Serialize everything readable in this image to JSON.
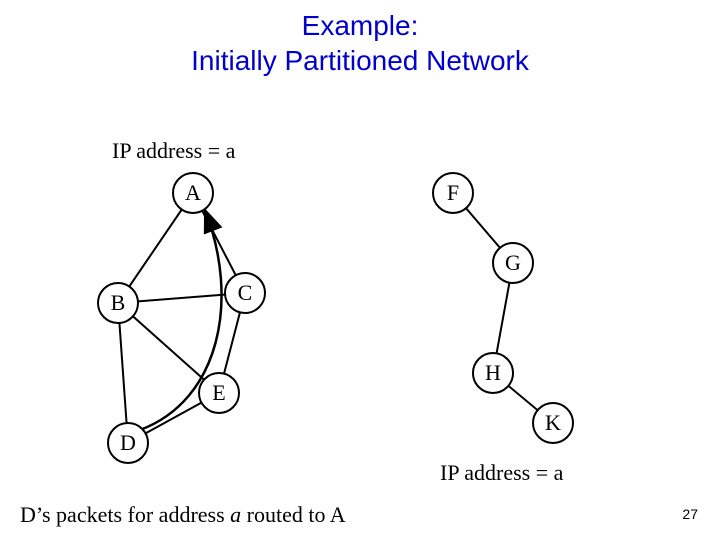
{
  "title_line1": "Example:",
  "title_line2": "Initially Partitioned Network",
  "ip_label_left": "IP address = a",
  "ip_label_right": "IP address = a",
  "nodes": {
    "A": "A",
    "B": "B",
    "C": "C",
    "D": "D",
    "E": "E",
    "F": "F",
    "G": "G",
    "H": "H",
    "K": "K"
  },
  "caption_prefix": "D’s packets for address ",
  "caption_var": "a",
  "caption_suffix": " routed to A",
  "page_number": "27",
  "chart_data": {
    "type": "diagram",
    "title": "Initially Partitioned Network",
    "components": [
      {
        "name": "left-partition",
        "nodes": [
          "A",
          "B",
          "C",
          "D",
          "E"
        ],
        "edges": [
          [
            "A",
            "B"
          ],
          [
            "A",
            "C"
          ],
          [
            "B",
            "C"
          ],
          [
            "B",
            "D"
          ],
          [
            "B",
            "E"
          ],
          [
            "C",
            "E"
          ],
          [
            "D",
            "E"
          ]
        ],
        "annotations": [
          {
            "node": "A",
            "text": "IP address = a"
          }
        ],
        "routed_path": {
          "from": "D",
          "to": "A"
        }
      },
      {
        "name": "right-partition",
        "nodes": [
          "F",
          "G",
          "H",
          "K"
        ],
        "edges": [
          [
            "F",
            "G"
          ],
          [
            "G",
            "H"
          ],
          [
            "H",
            "K"
          ]
        ],
        "annotations": [
          {
            "node": "K",
            "text": "IP address = a"
          }
        ]
      }
    ],
    "caption": "D’s packets for address a routed to A"
  }
}
